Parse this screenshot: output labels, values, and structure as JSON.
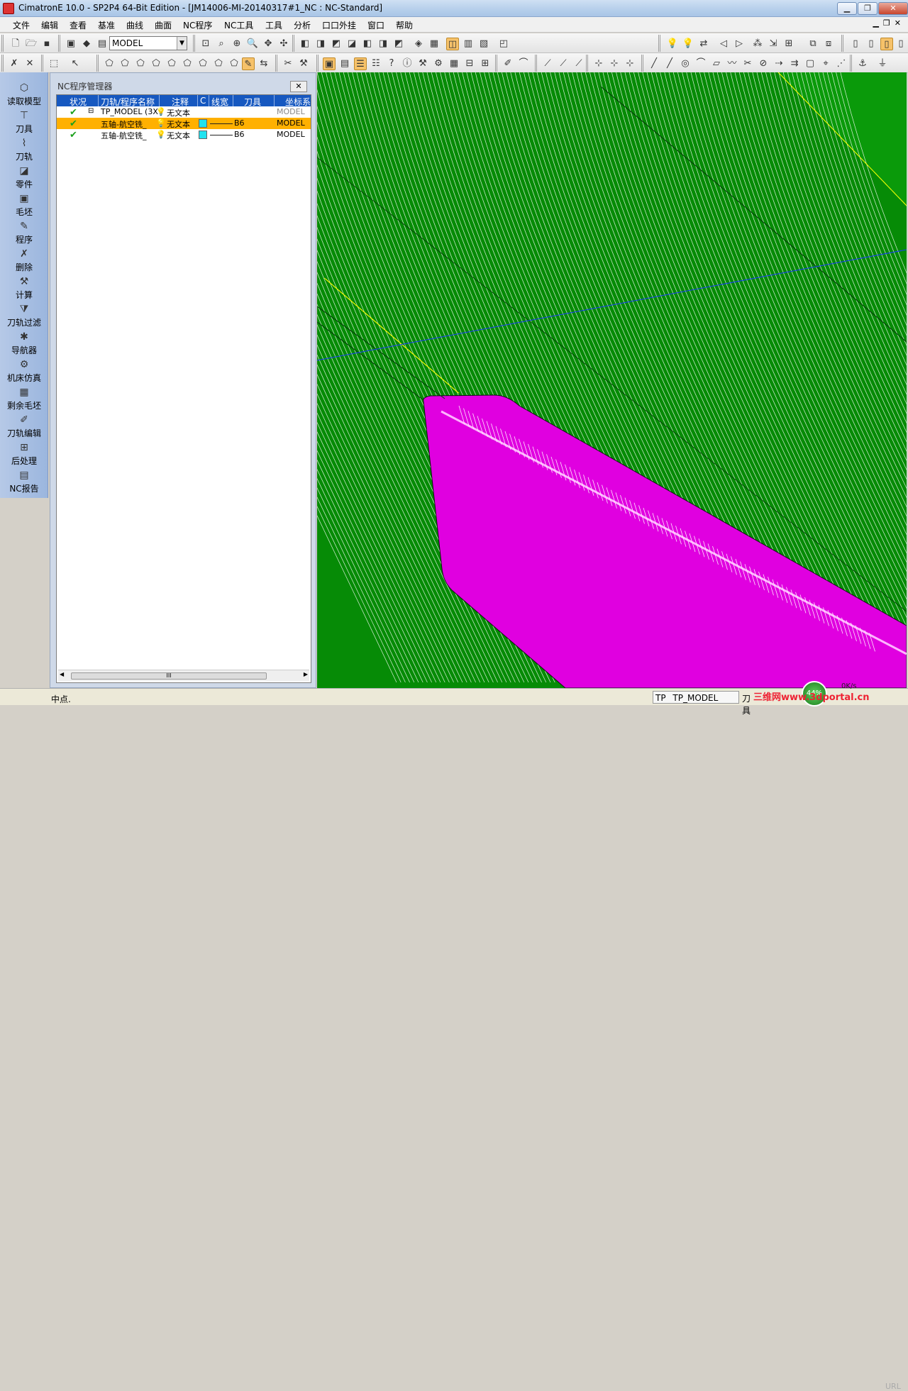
{
  "window": {
    "title": "CimatronE 10.0 - SP2P4 64-Bit Edition - [JM14006-MI-20140317#1_NC : NC-Standard]"
  },
  "menu": {
    "items": [
      "文件",
      "编辑",
      "查看",
      "基准",
      "曲线",
      "曲面",
      "NC程序",
      "NC工具",
      "工具",
      "分析",
      "口口外挂",
      "窗口",
      "帮助"
    ]
  },
  "toolbar": {
    "model_select": "MODEL"
  },
  "leftbar": {
    "items": [
      "读取模型",
      "刀具",
      "刀轨",
      "零件",
      "毛坯",
      "程序",
      "删除",
      "计算",
      "刀轨过滤",
      "导航器",
      "机床仿真",
      "剩余毛坯",
      "刀轨编辑",
      "后处理",
      "NC报告"
    ]
  },
  "nc_panel": {
    "title": "NC程序管理器",
    "columns": [
      "状况",
      "刀轨/程序名称",
      "注释",
      "C",
      "线宽",
      "刀具",
      "坐标系"
    ],
    "rows": [
      {
        "name": "TP_MODEL (3X",
        "comment": "无文本",
        "tool": "",
        "coord": "MODEL"
      },
      {
        "name": "五轴-航空铣_",
        "comment": "无文本",
        "tool": "B6",
        "coord": "MODEL"
      },
      {
        "name": "五轴-航空铣_",
        "comment": "无文本",
        "tool": "B6",
        "coord": "MODEL"
      }
    ],
    "scroll_thumb": "III"
  },
  "status": {
    "message": "中点.",
    "toolpath_label": "TP",
    "toolpath_value": "TP_MODEL",
    "tool_label": "刀具",
    "gauge": "44%",
    "speed": "0K/s",
    "watermark": "三维网www.3dportal.cn",
    "url": "URL"
  },
  "colors": {
    "viewport_bg": "#068b06",
    "toolpath_lines": "#ffffff",
    "toolpath_ends": "#ffff00",
    "part_magenta": "#e000e0",
    "axis_blue": "#1a3cff",
    "selected_row": "#ffb000"
  }
}
